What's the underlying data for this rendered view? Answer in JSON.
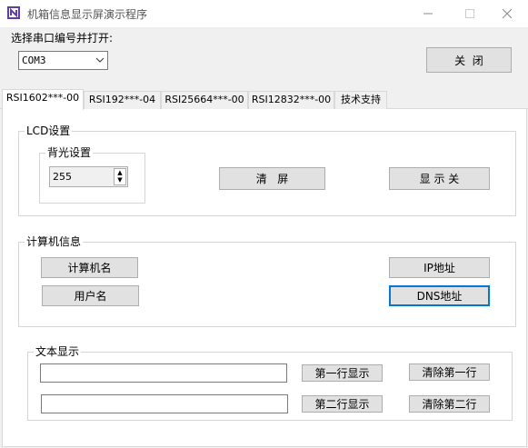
{
  "window": {
    "title": "机箱信息显示屏演示程序"
  },
  "port": {
    "label": "选择串口编号并打开:",
    "selected": "COM3",
    "close_button": "关  闭"
  },
  "tabs": [
    {
      "label": "RSI1602***-00",
      "active": true
    },
    {
      "label": "RSI192***-04"
    },
    {
      "label": "RSI25664***-00"
    },
    {
      "label": "RSI12832***-00"
    },
    {
      "label": "技术支持"
    }
  ],
  "lcd": {
    "group_title": "LCD设置",
    "backlight_title": "背光设置",
    "backlight_value": "255",
    "clear_button": "清   屏",
    "display_button": "显 示 关"
  },
  "computer": {
    "group_title": "计算机信息",
    "name_button": "计算机名",
    "user_button": "用户名",
    "ip_button": "IP地址",
    "dns_button": "DNS地址"
  },
  "text_display": {
    "group_title": "文本显示",
    "line1_value": "",
    "line2_value": "",
    "show_line1_button": "第一行显示",
    "show_line2_button": "第二行显示",
    "clear_line1_button": "清除第一行",
    "clear_line2_button": "清除第二行"
  },
  "colors": {
    "accent": "#6b4fbb",
    "focus": "#0078d7"
  }
}
